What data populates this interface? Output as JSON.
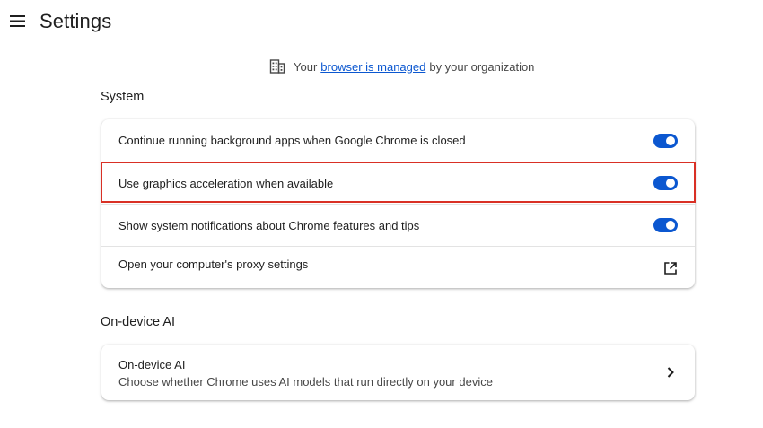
{
  "header": {
    "title": "Settings"
  },
  "managed_notice": {
    "prefix": "Your",
    "link": "browser is managed",
    "suffix": "by your organization"
  },
  "system": {
    "title": "System",
    "rows": [
      {
        "label": "Continue running background apps when Google Chrome is closed",
        "toggle": true
      },
      {
        "label": "Use graphics acceleration when available",
        "toggle": true
      },
      {
        "label": "Show system notifications about Chrome features and tips",
        "toggle": true
      },
      {
        "label": "Open your computer's proxy settings",
        "icon": "open-in-new-icon"
      }
    ]
  },
  "ai": {
    "title": "On-device AI",
    "row": {
      "label": "On-device AI",
      "sublabel": "Choose whether Chrome uses AI models that run directly on your device",
      "icon": "chevron-right-icon"
    }
  },
  "colors": {
    "accent": "#0b57d0",
    "highlight": "#d93025"
  }
}
